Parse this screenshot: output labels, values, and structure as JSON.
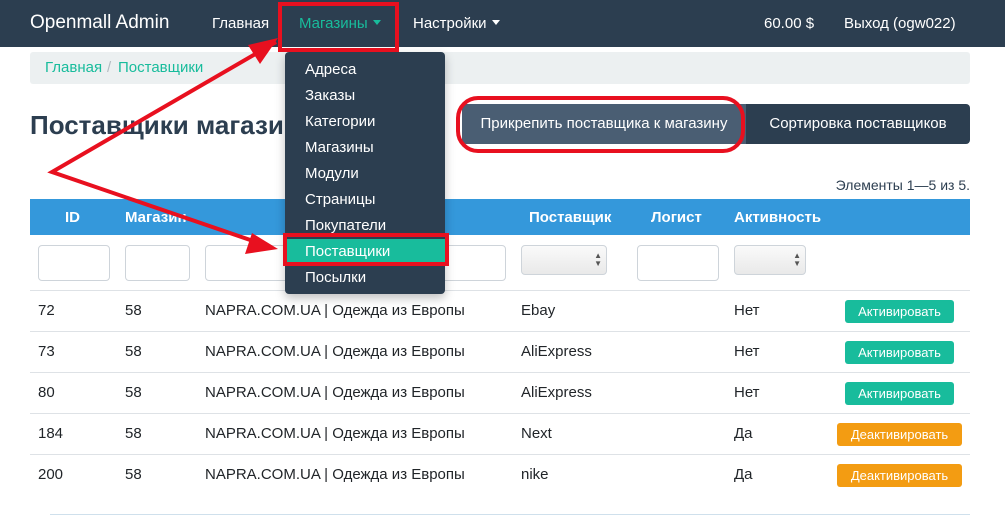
{
  "navbar": {
    "brand": "Openmall Admin",
    "home": "Главная",
    "shops": "Магазины",
    "settings": "Настройки",
    "balance": "60.00 $",
    "logout": "Выход (ogw022)"
  },
  "breadcrumb": {
    "items": [
      "Главная",
      "Поставщики"
    ],
    "separator": "/"
  },
  "page_title": "Поставщики магазинов",
  "actions": {
    "attach": "Прикрепить поставщика к магазину",
    "sort": "Сортировка поставщиков"
  },
  "summary": "Элементы 1—5 из 5.",
  "table": {
    "headers": [
      "ID",
      "Магазин",
      "Поставщик",
      "Логист",
      "Активность"
    ],
    "rows": [
      {
        "id": "72",
        "shop": "58",
        "name": "NAPRA.COM.UA | Одежда из Европы",
        "supplier": "Ebay",
        "active": "Нет",
        "action": "Активировать"
      },
      {
        "id": "73",
        "shop": "58",
        "name": "NAPRA.COM.UA | Одежда из Европы",
        "supplier": "AliExpress",
        "active": "Нет",
        "action": "Активировать"
      },
      {
        "id": "80",
        "shop": "58",
        "name": "NAPRA.COM.UA | Одежда из Европы",
        "supplier": "AliExpress",
        "active": "Нет",
        "action": "Активировать"
      },
      {
        "id": "184",
        "shop": "58",
        "name": "NAPRA.COM.UA | Одежда из Европы",
        "supplier": "Next",
        "active": "Да",
        "action": "Деактивировать"
      },
      {
        "id": "200",
        "shop": "58",
        "name": "NAPRA.COM.UA | Одежда из Европы",
        "supplier": "nike",
        "active": "Да",
        "action": "Деактивировать"
      }
    ]
  },
  "dropdown": {
    "items": [
      "Адреса",
      "Заказы",
      "Категории",
      "Магазины",
      "Модули",
      "Страницы",
      "Покупатели",
      "Поставщики",
      "Посылки"
    ],
    "active_index": 7
  },
  "colors": {
    "navbar": "#2c3e50",
    "accent": "#18bc9c",
    "table_header": "#3498db",
    "warning": "#f39c12",
    "annotation": "#e8101f"
  }
}
